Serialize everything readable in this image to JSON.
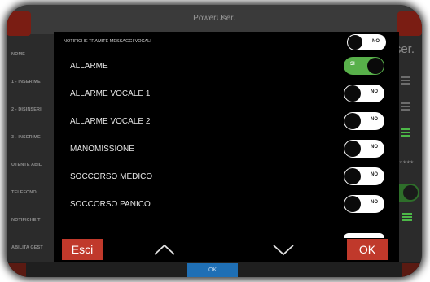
{
  "app": {
    "title": "PowerUser.",
    "background_right_label": "User."
  },
  "background": {
    "sidebar_labels": [
      "NOME",
      "1 - INSERIME",
      "2 - DISINSERI",
      "3 - INSERIME",
      "UTENTE ABIL",
      "TELEFONO",
      "NOTIFICHE T",
      "ABILITA GEST"
    ],
    "password_mask": "*****",
    "arrow": "-->",
    "bottom_ok_label": "OK"
  },
  "modal": {
    "header": {
      "label": "NOTIFICHE TRAMITE MESSAGGI VOCALI",
      "toggle_state": "NO"
    },
    "rows": [
      {
        "label": "ALLARME",
        "state": "SI",
        "on": true
      },
      {
        "label": "ALLARME VOCALE 1",
        "state": "NO",
        "on": false
      },
      {
        "label": "ALLARME VOCALE 2",
        "state": "NO",
        "on": false
      },
      {
        "label": "MANOMISSIONE",
        "state": "NO",
        "on": false
      },
      {
        "label": "SOCCORSO MEDICO",
        "state": "NO",
        "on": false
      },
      {
        "label": "SOCCORSO PANICO",
        "state": "NO",
        "on": false
      }
    ],
    "footer": {
      "cancel_label": "Esci",
      "confirm_label": "OK",
      "up_icon": "chevron-up-icon",
      "down_icon": "chevron-down-icon"
    }
  },
  "colors": {
    "on_green": "#58b04a",
    "button_red": "#c0392b",
    "ok_blue": "#1f6fb5"
  }
}
